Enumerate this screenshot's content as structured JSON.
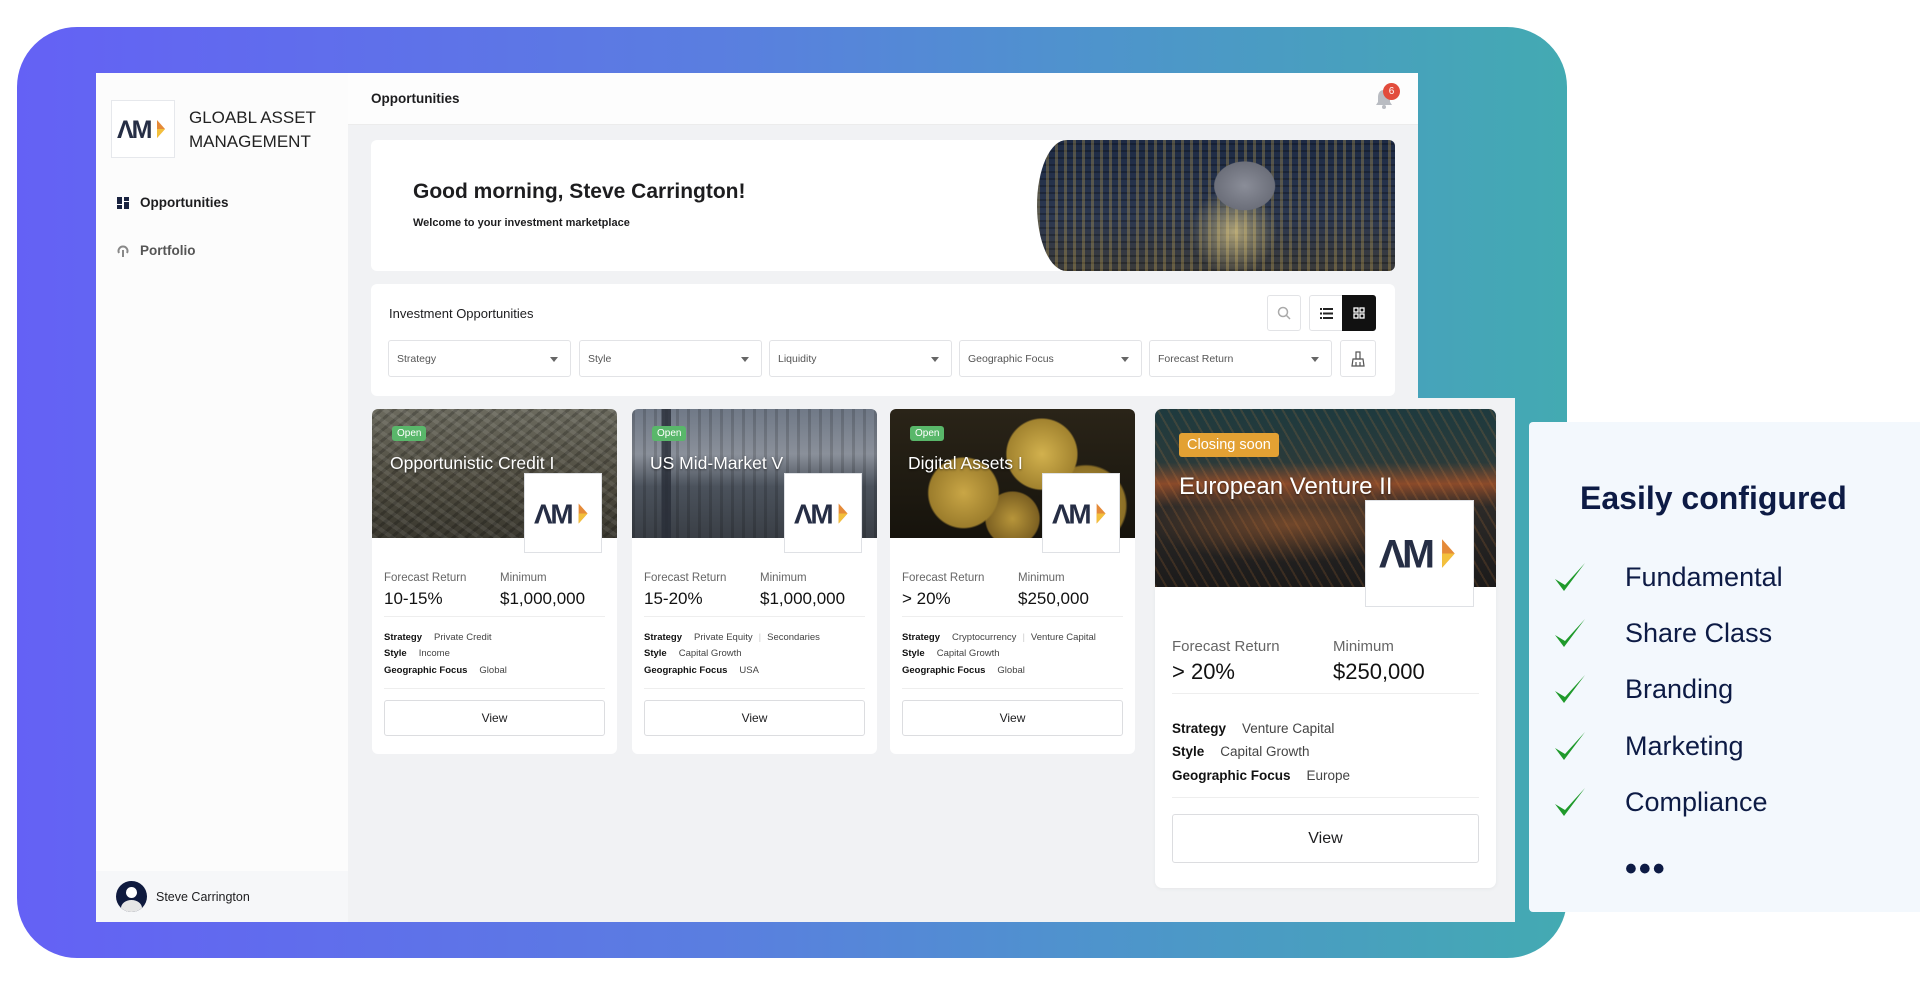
{
  "colors": {
    "gradient_start": "#6461f5",
    "gradient_end": "#43aab2",
    "open_badge": "#59b76a",
    "closing_badge": "#e3a133",
    "notification": "#e24c3c",
    "panel_text": "#0d1b45",
    "check": "#1f9a2b"
  },
  "sidebar": {
    "brand_line1": "GLOABL ASSET",
    "brand_line2": "MANAGEMENT",
    "logo_text": "AM",
    "items": [
      {
        "label": "Opportunities",
        "icon": "dashboard-icon",
        "active": true
      },
      {
        "label": "Portfolio",
        "icon": "portfolio-icon",
        "active": false
      }
    ],
    "user_name": "Steve Carrington"
  },
  "header": {
    "title": "Opportunities",
    "notification_count": "6"
  },
  "welcome": {
    "greeting": "Good morning, Steve Carrington!",
    "subtitle": "Welcome to your investment marketplace"
  },
  "filters": {
    "title": "Investment Opportunities",
    "dropdowns": [
      "Strategy",
      "Style",
      "Liquidity",
      "Geographic Focus",
      "Forecast Return"
    ],
    "view_mode": "grid"
  },
  "labels": {
    "forecast_return": "Forecast Return",
    "minimum": "Minimum",
    "strategy": "Strategy",
    "style": "Style",
    "geographic_focus": "Geographic Focus",
    "view": "View"
  },
  "cards": [
    {
      "status": "Open",
      "title": "Opportunistic Credit I",
      "forecast_return": "10-15%",
      "minimum": "$1,000,000",
      "strategy": [
        "Private Credit"
      ],
      "style": "Income",
      "geographic_focus": "Global"
    },
    {
      "status": "Open",
      "title": "US Mid-Market V",
      "forecast_return": "15-20%",
      "minimum": "$1,000,000",
      "strategy": [
        "Private Equity",
        "Secondaries"
      ],
      "style": "Capital Growth",
      "geographic_focus": "USA"
    },
    {
      "status": "Open",
      "title": "Digital Assets I",
      "forecast_return": "> 20%",
      "minimum": "$250,000",
      "strategy": [
        "Cryptocurrency",
        "Venture Capital"
      ],
      "style": "Capital Growth",
      "geographic_focus": "Global"
    }
  ],
  "featured": {
    "status": "Closing soon",
    "title": "European Venture II",
    "forecast_return": "> 20%",
    "minimum": "$250,000",
    "strategy": [
      "Venture Capital"
    ],
    "style": "Capital Growth",
    "geographic_focus": "Europe"
  },
  "panel": {
    "title": "Easily configured",
    "items": [
      "Fundamental",
      "Share Class",
      "Branding",
      "Marketing",
      "Compliance"
    ],
    "more": "•••"
  }
}
